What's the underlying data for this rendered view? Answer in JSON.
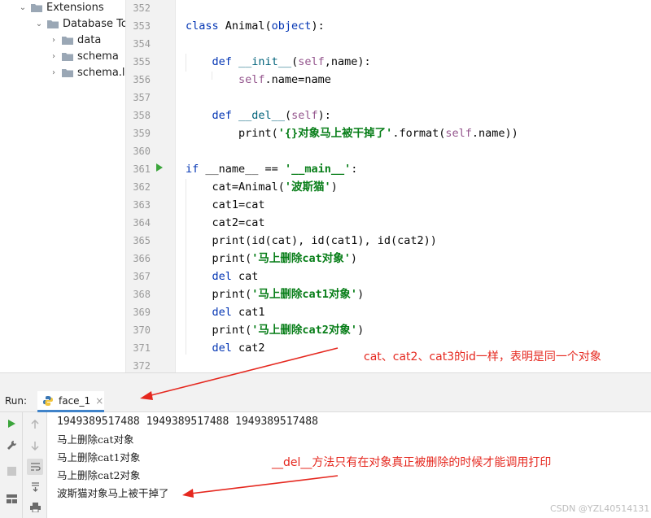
{
  "project_tree": {
    "items": [
      {
        "label": "Extensions",
        "expanded": true,
        "level": 0
      },
      {
        "label": "Database Too",
        "expanded": true,
        "level": 1
      },
      {
        "label": "data",
        "expanded": false,
        "level": 2
      },
      {
        "label": "schema",
        "expanded": false,
        "level": 2
      },
      {
        "label": "schema.lay",
        "expanded": false,
        "level": 2
      }
    ]
  },
  "editor": {
    "line_numbers": [
      "352",
      "353",
      "354",
      "355",
      "356",
      "357",
      "358",
      "359",
      "360",
      "361",
      "362",
      "363",
      "364",
      "365",
      "366",
      "367",
      "368",
      "369",
      "370",
      "371",
      "372"
    ],
    "lines": [
      "",
      "class Animal(object):",
      "",
      "    def __init__(self,name):",
      "        self.name=name",
      "",
      "    def __del__(self):",
      "        print('{}对象马上被干掉了'.format(self.name))",
      "",
      "if __name__ == '__main__':",
      "    cat=Animal('波斯猫')",
      "    cat1=cat",
      "    cat2=cat",
      "    print(id(cat), id(cat1), id(cat2))",
      "    print('马上删除cat对象')",
      "    del cat",
      "    print('马上删除cat1对象')",
      "    del cat1",
      "    print('马上删除cat2对象')",
      "    del cat2",
      ""
    ],
    "run_gutter_line": "361"
  },
  "run_panel": {
    "label": "Run:",
    "tab_label": "face_1",
    "tab_close": "×",
    "output": [
      "1949389517488 1949389517488 1949389517488",
      "马上删除cat对象",
      "马上删除cat1对象",
      "马上删除cat2对象",
      "波斯猫对象马上被干掉了"
    ]
  },
  "annotations": {
    "note_1": "cat、cat2、cat3的id一样，表明是同一个对象",
    "note_2": "__del__方法只有在对象真正被删除的时候才能调用打印"
  },
  "watermark": "CSDN @YZL40514131",
  "colors": {
    "annotation": "#e5281f",
    "keyword": "#0033b3",
    "string": "#067d17",
    "self": "#94558d",
    "tab_underline": "#4083c9",
    "run_icon": "#3ba53b"
  }
}
